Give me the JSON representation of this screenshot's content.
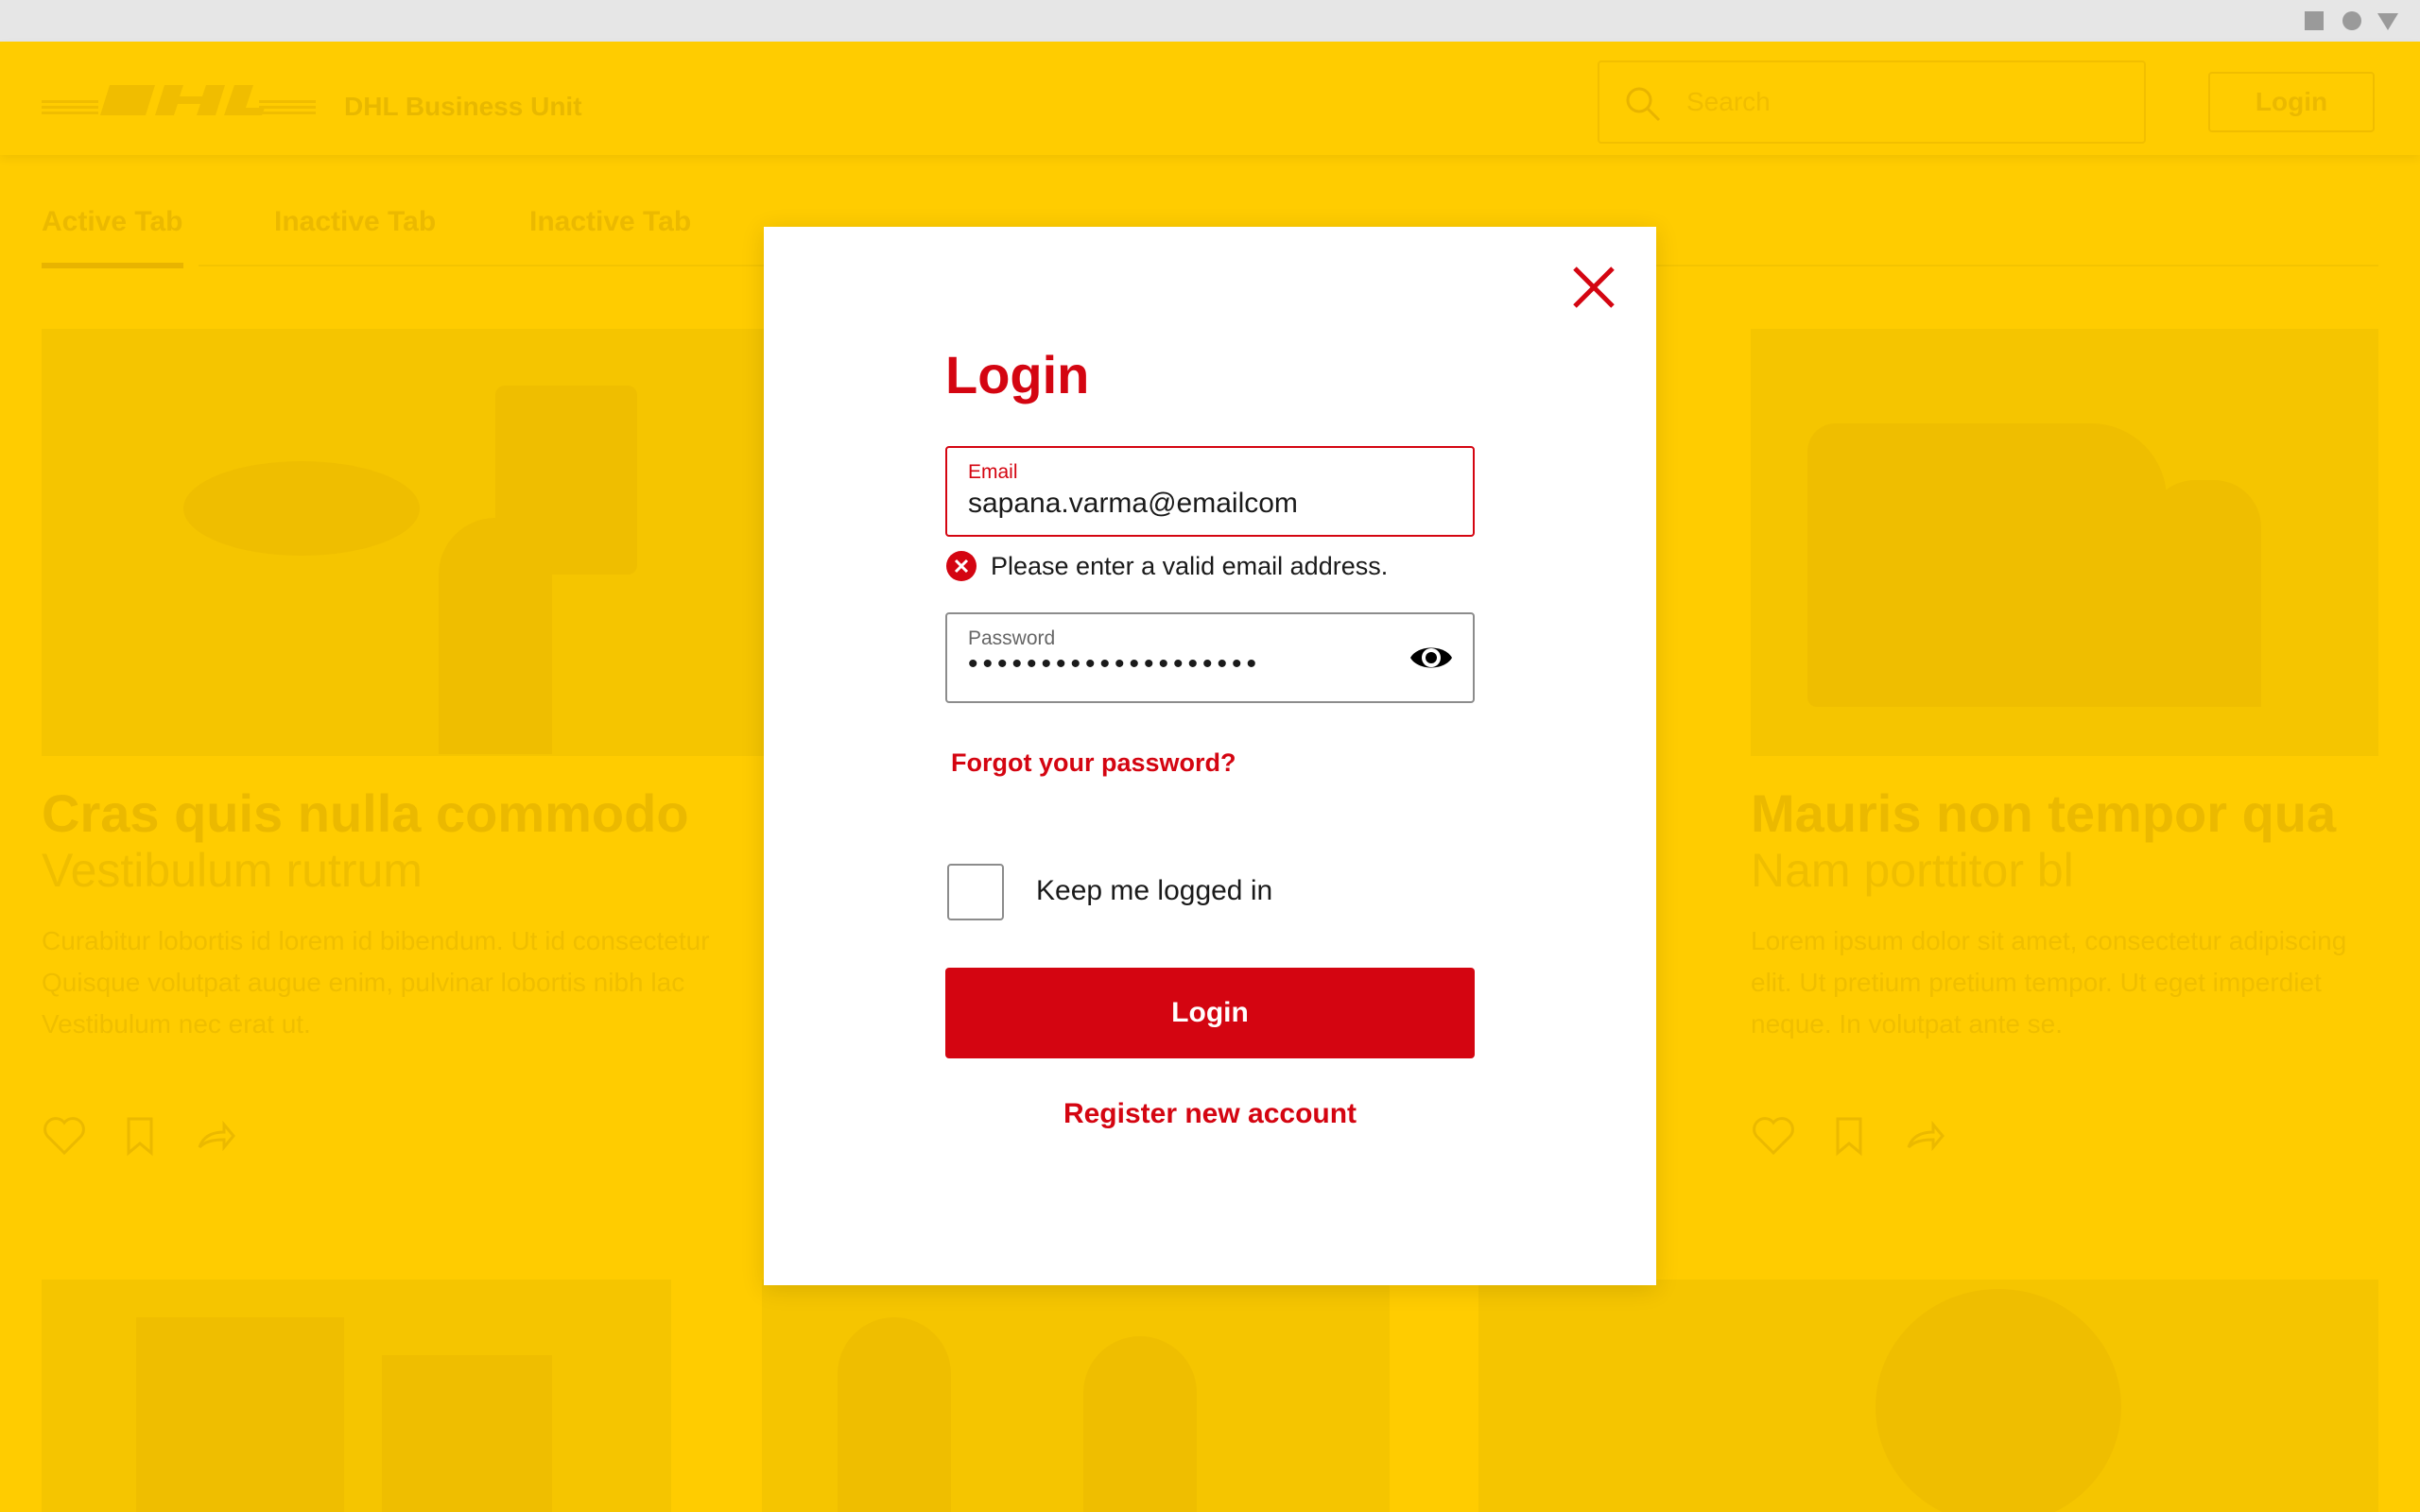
{
  "colors": {
    "brand_yellow": "#FFCC00",
    "brand_red": "#D40511",
    "error_red": "#D40511",
    "border_gray": "#8C8C8C"
  },
  "background_page": {
    "header": {
      "logo": "DHL",
      "business_unit": "DHL Business Unit",
      "search_placeholder": "Search",
      "login_label": "Login"
    },
    "tabs": [
      {
        "label": "Active Tab",
        "active": true
      },
      {
        "label": "Inactive Tab",
        "active": false
      },
      {
        "label": "Inactive Tab",
        "active": false
      }
    ],
    "cards": [
      {
        "title": "Cras quis nulla commodo",
        "subtitle": "Vestibulum rutrum",
        "body": "Curabitur lobortis id lorem id bibendum. Ut id consectetur Quisque volutpat augue enim, pulvinar lobortis nibh lac Vestibulum nec erat ut."
      },
      {
        "title": "Mauris non tempor qua",
        "subtitle": "Nam porttitor bl",
        "body": "Lorem ipsum dolor sit amet, consectetur adipiscing elit. Ut pretium pretium tempor. Ut eget imperdiet neque. In volutpat ante se."
      }
    ],
    "card_action_icons": [
      "heart-icon",
      "bookmark-icon",
      "share-icon"
    ]
  },
  "modal": {
    "title": "Login",
    "close_icon": "close-icon",
    "email": {
      "label": "Email",
      "value": "sapana.varma@emailcom"
    },
    "email_error": "Please enter a valid email address.",
    "password": {
      "label": "Password",
      "value": "••••••••••••••••••••",
      "toggle_icon": "eye-icon"
    },
    "forgot_password": "Forgot your password?",
    "keep_logged_in": {
      "label": "Keep me logged in",
      "checked": false
    },
    "login_button": "Login",
    "register_link": "Register new account"
  }
}
